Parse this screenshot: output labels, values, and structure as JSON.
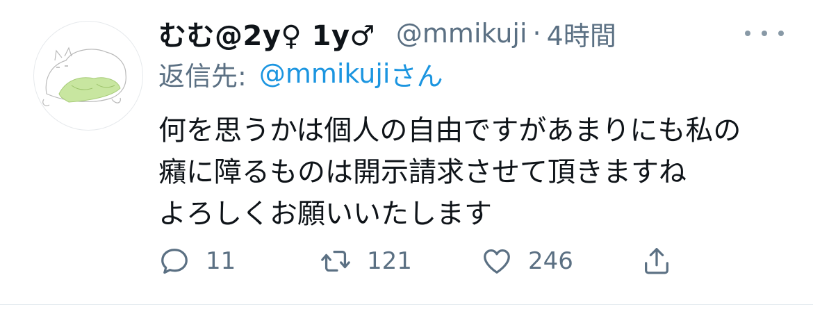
{
  "tweet": {
    "author": {
      "display_name": "むむ@2y♀ 1y♂",
      "handle": "@mmikuji",
      "separator": "·",
      "time": "4時間"
    },
    "reply": {
      "prefix": "返信先:",
      "mention": "@mmikuji",
      "suffix": "さん"
    },
    "body_lines": [
      "何を思うかは個人の自由ですがあまりにも私の",
      "癪に障るものは開示請求させて頂きますね",
      "よろしくお願いいたします"
    ],
    "actions": {
      "reply": {
        "icon": "reply-icon",
        "count": "11"
      },
      "retweet": {
        "icon": "retweet-icon",
        "count": "121"
      },
      "like": {
        "icon": "heart-icon",
        "count": "246"
      },
      "share": {
        "icon": "share-icon"
      }
    },
    "more_icon": "more-icon"
  },
  "colors": {
    "text": "#0f1419",
    "secondary": "#5b7083",
    "link": "#1b95e0",
    "divider": "#e6ecf0",
    "avatar_green": "#c8e6a0"
  }
}
